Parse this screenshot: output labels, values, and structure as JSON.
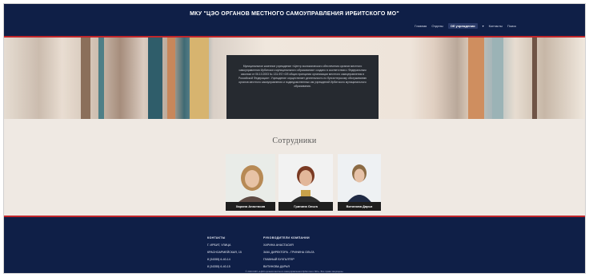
{
  "header": {
    "title": "МКУ \"ЦЭО ОРГАНОВ МЕСТНОГО САМОУПРАВЛЕНИЯ ИРБИТСКОГО МО\"",
    "nav": [
      "Главная",
      "Отделы",
      "Об учреждении",
      "Контакты",
      "Поиск"
    ]
  },
  "hero": {
    "paragraph": "Муниципальное казенное учреждение «Центр экономического обеспечения органов местного самоуправления Ирбитского муниципального образования» создано в соответствии с Федеральным законом от 06.10.2003 № 131-ФЗ «Об общих принципах организации местного самоуправления в Российской Федерации». Учреждение осуществляет деятельность по бухгалтерскому обслуживанию органов местного самоуправления и подведомственных им учреждений Ирбитского муниципального образования."
  },
  "staff": {
    "title": "Сотрудники",
    "people": [
      {
        "name": "Харина Анастасия"
      },
      {
        "name": "Гринина Ольга"
      },
      {
        "name": "Витинова Дарья"
      }
    ]
  },
  "footer": {
    "col1": {
      "heading": "КОНТАКТЫ",
      "lines": [
        "Г. ИРБИТ, УЛИЦА",
        "КРАСНОАРМЕЙСКАЯ, 15",
        "8 (34355) 6-40-14",
        "8 (34355) 6-40-15"
      ]
    },
    "col2": {
      "heading": "РУКОВОДИТЕЛИ КОМПАНИИ",
      "lines": [
        "ХАРИНА АНАСТАСИЯ",
        "ЗАМ. ДИРЕКТОРА - ГРИНИНА ОЛЬГА",
        "ГЛАВНЫЙ БУХГАЛТЕР",
        "ВИТИНОВА ДАРЬЯ"
      ]
    },
    "note": "© 2024 МКУ «ЦЭО органов местного самоуправления Ирбитского МО». Все права защищены."
  },
  "colors": {
    "navy": "#0f1f47",
    "accent": "#c0262b",
    "panel": "#262a30",
    "bg": "#efe9e3"
  }
}
